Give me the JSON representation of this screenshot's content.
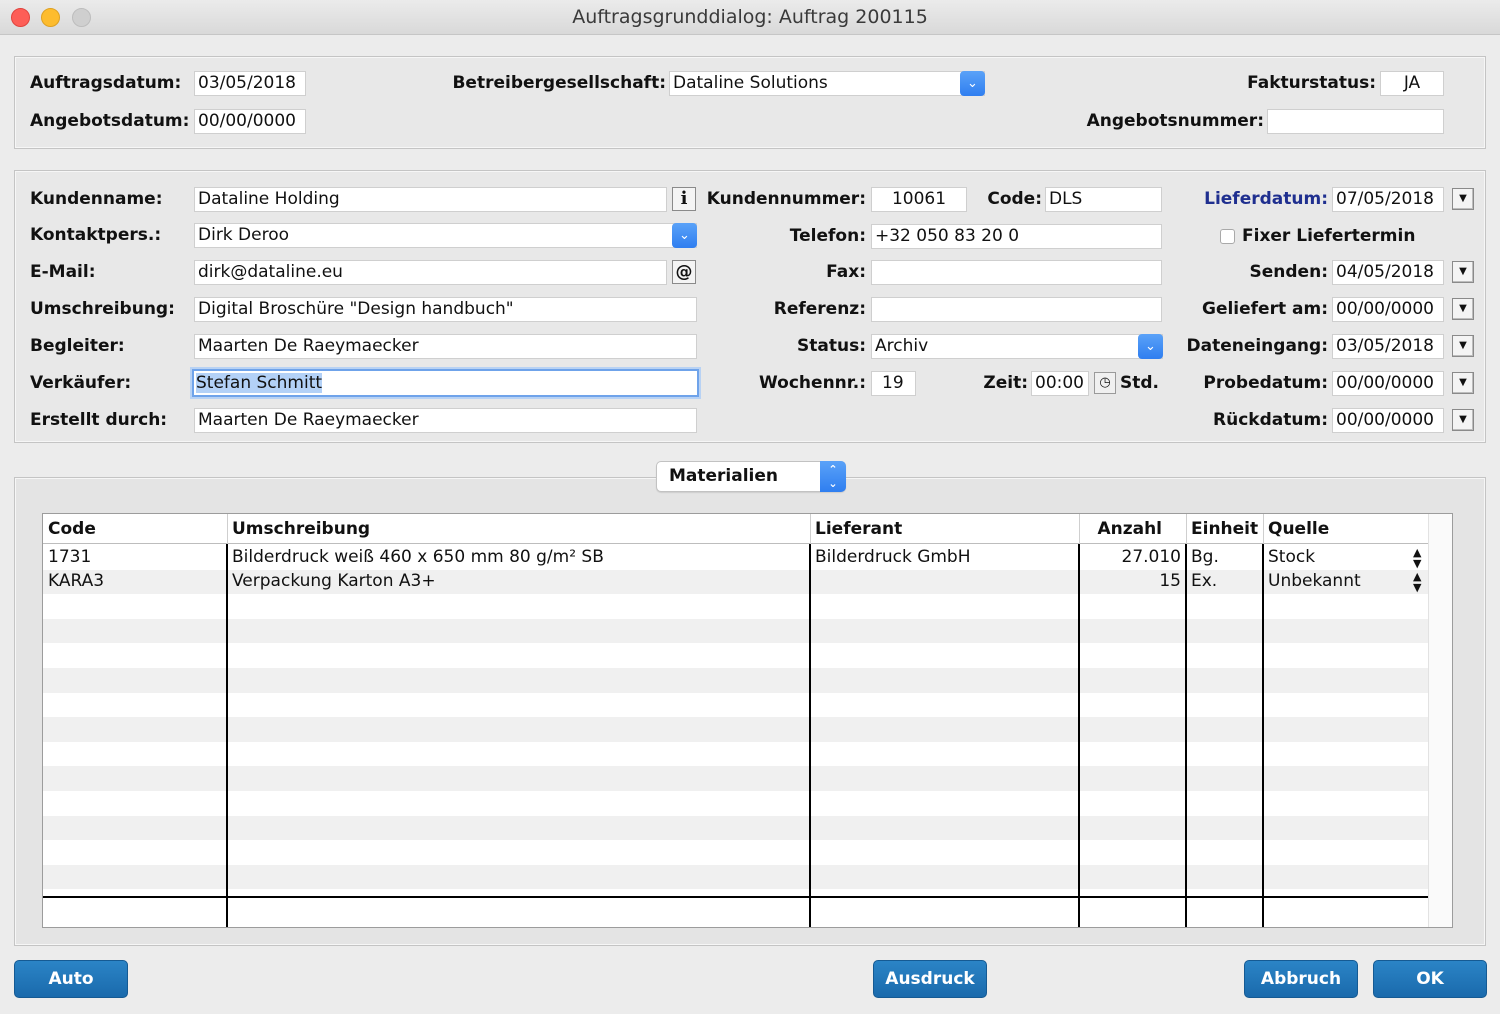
{
  "window": {
    "title": "Auftragsgrunddialog: Auftrag 200115"
  },
  "header": {
    "auftragsdatum_label": "Auftragsdatum:",
    "auftragsdatum": "03/05/2018",
    "angebotsdatum_label": "Angebotsdatum:",
    "angebotsdatum": "00/00/0000",
    "betreiber_label": "Betreibergesellschaft:",
    "betreiber": "Dataline Solutions",
    "fakturstatus_label": "Fakturstatus:",
    "fakturstatus": "JA",
    "angebotsnummer_label": "Angebotsnummer:",
    "angebotsnummer": ""
  },
  "customer": {
    "kundenname_label": "Kundenname:",
    "kundenname": "Dataline Holding",
    "kontakt_label": "Kontaktpers.:",
    "kontakt": "Dirk Deroo",
    "email_label": "E-Mail:",
    "email": "dirk@dataline.eu",
    "umschreibung_label": "Umschreibung:",
    "umschreibung": "Digital Broschüre \"Design handbuch\"",
    "begleiter_label": "Begleiter:",
    "begleiter": "Maarten De Raeymaecker",
    "verkaeufer_label": "Verkäufer:",
    "verkaeufer": "Stefan Schmitt",
    "erstellt_label": "Erstellt durch:",
    "erstellt": "Maarten De Raeymaecker",
    "kundennummer_label": "Kundennummer:",
    "kundennummer": "10061",
    "code_label": "Code:",
    "code": "DLS",
    "telefon_label": "Telefon:",
    "telefon": "+32 050 83 20 0",
    "fax_label": "Fax:",
    "fax": "",
    "referenz_label": "Referenz:",
    "referenz": "",
    "status_label": "Status:",
    "status": "Archiv",
    "wochennr_label": "Wochennr.:",
    "wochennr": "19",
    "zeit_label": "Zeit:",
    "zeit": "00:00",
    "std_label": "Std.",
    "info_icon_glyph": "i",
    "email_icon_glyph": "@"
  },
  "dates": {
    "lieferdatum_label": "Lieferdatum:",
    "lieferdatum": "07/05/2018",
    "fixer_label": "Fixer Liefertermin",
    "senden_label": "Senden:",
    "senden": "04/05/2018",
    "geliefert_label": "Geliefert am:",
    "geliefert": "00/00/0000",
    "dateneingang_label": "Dateneingang:",
    "dateneingang": "03/05/2018",
    "probedatum_label": "Probedatum:",
    "probedatum": "00/00/0000",
    "rueckdatum_label": "Rückdatum:",
    "rueckdatum": "00/00/0000"
  },
  "materials": {
    "selector": "Materialien",
    "columns": [
      "Code",
      "Umschreibung",
      "Lieferant",
      "Anzahl",
      "Einheit",
      "Quelle"
    ],
    "rows": [
      {
        "code": "1731",
        "umschreibung": "Bilderdruck weiß 460 x 650 mm 80 g/m² SB",
        "lieferant": "Bilderdruck GmbH",
        "anzahl": "27.010",
        "einheit": "Bg.",
        "quelle": "Stock"
      },
      {
        "code": "KARA3",
        "umschreibung": "Verpackung Karton A3+",
        "lieferant": "",
        "anzahl": "15",
        "einheit": "Ex.",
        "quelle": "Unbekannt"
      }
    ]
  },
  "buttons": {
    "auto": "Auto",
    "ausdruck": "Ausdruck",
    "abbruch": "Abbruch",
    "ok": "OK"
  },
  "colors": {
    "accent": "#1f75b9",
    "combo_blue": "#3b86f3",
    "lieferdatum_label": "#1f2f8f"
  }
}
